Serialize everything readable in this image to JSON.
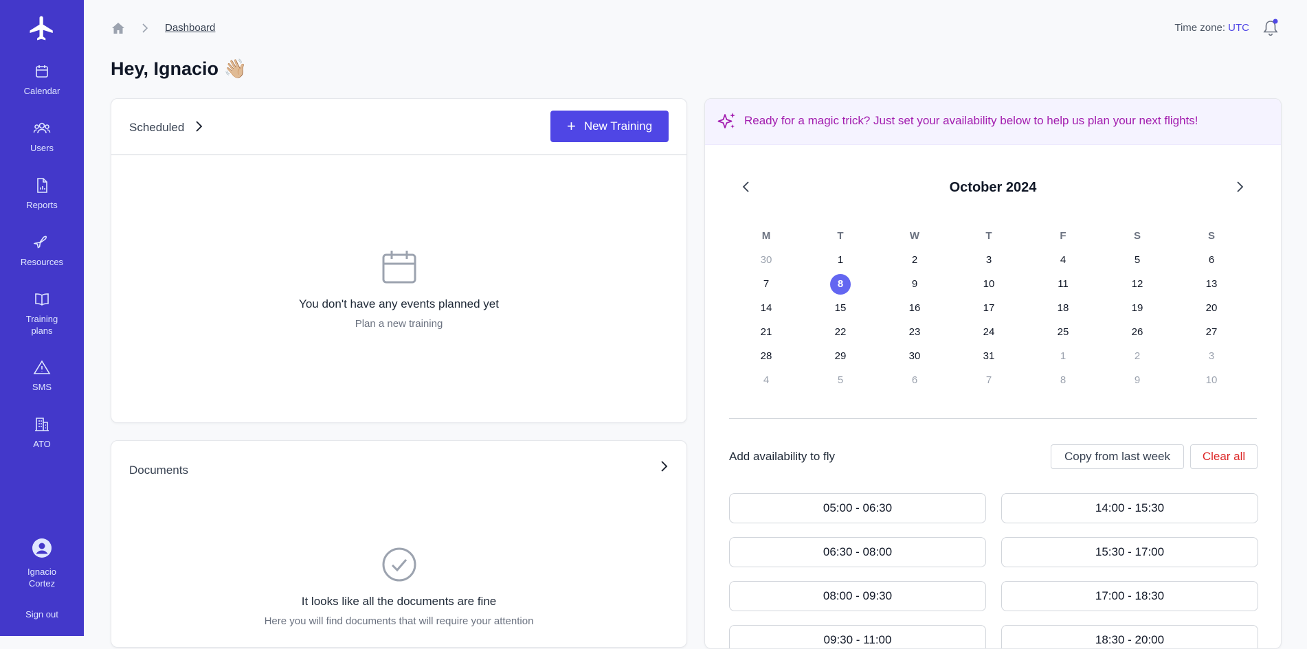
{
  "sidebar": {
    "items": [
      {
        "label": "Calendar",
        "icon": "calendar-icon"
      },
      {
        "label": "Users",
        "icon": "users-icon"
      },
      {
        "label": "Reports",
        "icon": "report-icon"
      },
      {
        "label": "Resources",
        "icon": "plane-icon"
      },
      {
        "label": "Training\nplans",
        "icon": "book-icon"
      },
      {
        "label": "SMS",
        "icon": "warning-icon"
      },
      {
        "label": "ATO",
        "icon": "building-icon"
      }
    ],
    "user_name": "Ignacio\nCortez",
    "sign_out": "Sign out"
  },
  "header": {
    "breadcrumb": "Dashboard",
    "timezone_label": "Time zone:",
    "timezone_value": "UTC"
  },
  "greeting": "Hey, Ignacio 👋🏼",
  "scheduled": {
    "title": "Scheduled",
    "new_button": "New Training",
    "empty_title": "You don't have any events planned yet",
    "empty_sub": "Plan a new training"
  },
  "documents": {
    "title": "Documents",
    "empty_title": "It looks like all the documents are fine",
    "empty_sub": "Here you will find documents that will require your attention"
  },
  "magic": {
    "text": "Ready for a magic trick? Just set your availability below to help us plan your next flights!"
  },
  "calendar": {
    "month": "October 2024",
    "dow": [
      "M",
      "T",
      "W",
      "T",
      "F",
      "S",
      "S"
    ],
    "weeks": [
      [
        {
          "d": "30",
          "m": true
        },
        {
          "d": "1"
        },
        {
          "d": "2"
        },
        {
          "d": "3"
        },
        {
          "d": "4"
        },
        {
          "d": "5"
        },
        {
          "d": "6"
        }
      ],
      [
        {
          "d": "7"
        },
        {
          "d": "8",
          "sel": true
        },
        {
          "d": "9"
        },
        {
          "d": "10"
        },
        {
          "d": "11"
        },
        {
          "d": "12"
        },
        {
          "d": "13"
        }
      ],
      [
        {
          "d": "14"
        },
        {
          "d": "15"
        },
        {
          "d": "16"
        },
        {
          "d": "17"
        },
        {
          "d": "18"
        },
        {
          "d": "19"
        },
        {
          "d": "20"
        }
      ],
      [
        {
          "d": "21"
        },
        {
          "d": "22"
        },
        {
          "d": "23"
        },
        {
          "d": "24"
        },
        {
          "d": "25"
        },
        {
          "d": "26"
        },
        {
          "d": "27"
        }
      ],
      [
        {
          "d": "28"
        },
        {
          "d": "29"
        },
        {
          "d": "30"
        },
        {
          "d": "31"
        },
        {
          "d": "1",
          "m": true
        },
        {
          "d": "2",
          "m": true
        },
        {
          "d": "3",
          "m": true
        }
      ],
      [
        {
          "d": "4",
          "m": true
        },
        {
          "d": "5",
          "m": true
        },
        {
          "d": "6",
          "m": true
        },
        {
          "d": "7",
          "m": true
        },
        {
          "d": "8",
          "m": true
        },
        {
          "d": "9",
          "m": true
        },
        {
          "d": "10",
          "m": true
        }
      ]
    ]
  },
  "availability": {
    "title": "Add availability to fly",
    "copy_button": "Copy from last week",
    "clear_button": "Clear all",
    "slots_left": [
      "05:00 - 06:30",
      "06:30 - 08:00",
      "08:00 - 09:30",
      "09:30 - 11:00"
    ],
    "slots_right": [
      "14:00 - 15:30",
      "15:30 - 17:00",
      "17:00 - 18:30",
      "18:30 - 20:00"
    ]
  },
  "colors": {
    "sidebar": "#4338ca",
    "accent": "#4f46e5",
    "magic_text": "#a21caf",
    "danger": "#dc2626"
  }
}
